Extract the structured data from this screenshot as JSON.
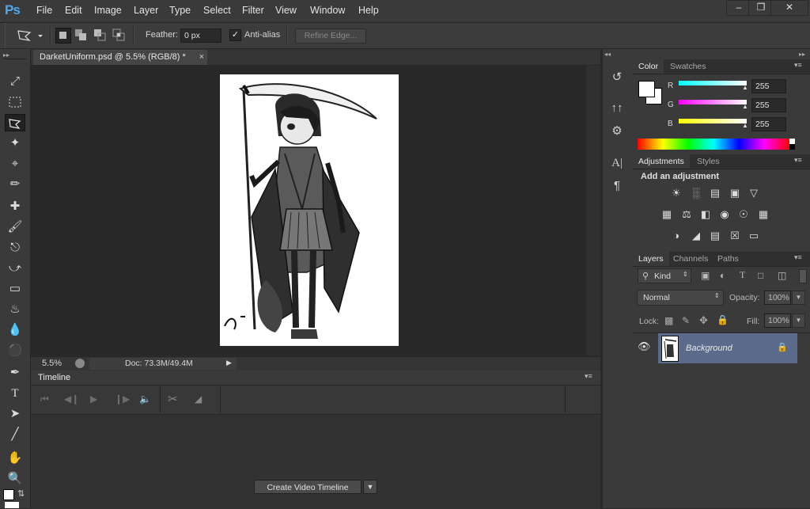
{
  "menubar": {
    "logo": "Ps",
    "items": [
      "File",
      "Edit",
      "Image",
      "Layer",
      "Type",
      "Select",
      "Filter",
      "View",
      "Window",
      "Help"
    ]
  },
  "options": {
    "feather_label": "Feather:",
    "feather_value": "0 px",
    "antialias_label": "Anti-alias",
    "antialias_checked": true,
    "refine_edge_label": "Refine Edge..."
  },
  "document": {
    "tab_title": "DarketUniform.psd @ 5.5% (RGB/8) *",
    "zoom": "5.5%",
    "doc_info": "Doc: 73.3M/49.4M"
  },
  "timeline": {
    "title": "Timeline",
    "create_button": "Create Video Timeline"
  },
  "color_panel": {
    "tabs": [
      "Color",
      "Swatches"
    ],
    "channels": [
      {
        "label": "R",
        "value": "255",
        "gradient": "#00ffff"
      },
      {
        "label": "G",
        "value": "255",
        "gradient": "#ff00ff"
      },
      {
        "label": "B",
        "value": "255",
        "gradient": "#ffff00"
      }
    ]
  },
  "adjustments_panel": {
    "tabs": [
      "Adjustments",
      "Styles"
    ],
    "heading": "Add an adjustment"
  },
  "layers_panel": {
    "tabs": [
      "Layers",
      "Channels",
      "Paths"
    ],
    "kind_label": "Kind",
    "blend_mode": "Normal",
    "opacity_label": "Opacity:",
    "opacity_value": "100%",
    "lock_label": "Lock:",
    "fill_label": "Fill:",
    "fill_value": "100%",
    "layers": [
      {
        "name": "Background",
        "locked": true,
        "visible": true
      }
    ]
  },
  "colors": {
    "accent": "#4fa7f0",
    "selected_layer": "#5b6b8c"
  }
}
